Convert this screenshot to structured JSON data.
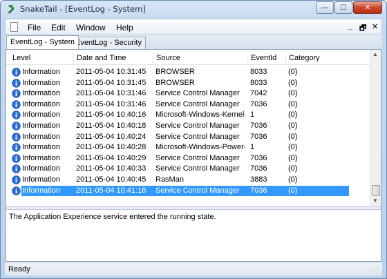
{
  "window": {
    "title": "SnakeTail - [EventLog - System]",
    "buttons": {
      "minimize": "—",
      "maximize": "☐",
      "close": "✕"
    }
  },
  "menu": {
    "items": [
      "File",
      "Edit",
      "Window",
      "Help"
    ],
    "mdi": {
      "minimize": "_",
      "restore": "🗗",
      "close": "✕"
    }
  },
  "tabs": [
    {
      "label": "EventLog - System",
      "active": true
    },
    {
      "label": "EventLog - Security",
      "active": false
    }
  ],
  "table": {
    "columns": [
      "Level",
      "Date and Time",
      "Source",
      "EventId",
      "Category"
    ],
    "rows": [
      {
        "level": "Information",
        "datetime": "2011-05-04 10:31:45",
        "source": "BROWSER",
        "eventid": "8033",
        "category": "(0)"
      },
      {
        "level": "Information",
        "datetime": "2011-05-04 10:31:45",
        "source": "BROWSER",
        "eventid": "8033",
        "category": "(0)"
      },
      {
        "level": "Information",
        "datetime": "2011-05-04 10:31:46",
        "source": "Service Control Manager",
        "eventid": "7042",
        "category": "(0)"
      },
      {
        "level": "Information",
        "datetime": "2011-05-04 10:31:46",
        "source": "Service Control Manager",
        "eventid": "7036",
        "category": "(0)"
      },
      {
        "level": "Information",
        "datetime": "2011-05-04 10:40:16",
        "source": "Microsoft-Windows-Kernel-...",
        "eventid": "1",
        "category": "(0)"
      },
      {
        "level": "Information",
        "datetime": "2011-05-04 10:40:18",
        "source": "Service Control Manager",
        "eventid": "7036",
        "category": "(0)"
      },
      {
        "level": "Information",
        "datetime": "2011-05-04 10:40:24",
        "source": "Service Control Manager",
        "eventid": "7036",
        "category": "(0)"
      },
      {
        "level": "Information",
        "datetime": "2011-05-04 10:40:28",
        "source": "Microsoft-Windows-Power-...",
        "eventid": "1",
        "category": "(0)"
      },
      {
        "level": "Information",
        "datetime": "2011-05-04 10:40:29",
        "source": "Service Control Manager",
        "eventid": "7036",
        "category": "(0)"
      },
      {
        "level": "Information",
        "datetime": "2011-05-04 10:40:33",
        "source": "Service Control Manager",
        "eventid": "7036",
        "category": "(0)"
      },
      {
        "level": "Information",
        "datetime": "2011-05-04 10:40:45",
        "source": "RasMan",
        "eventid": "3883",
        "category": "(0)"
      },
      {
        "level": "Information",
        "datetime": "2011-05-04 10:41:16",
        "source": "Service Control Manager",
        "eventid": "7036",
        "category": "(0)",
        "selected": true
      }
    ]
  },
  "message": "The Application Experience service entered the running state.",
  "status": "Ready",
  "colors": {
    "selection": "#3399ff",
    "info_icon": "#2a6fd6"
  }
}
